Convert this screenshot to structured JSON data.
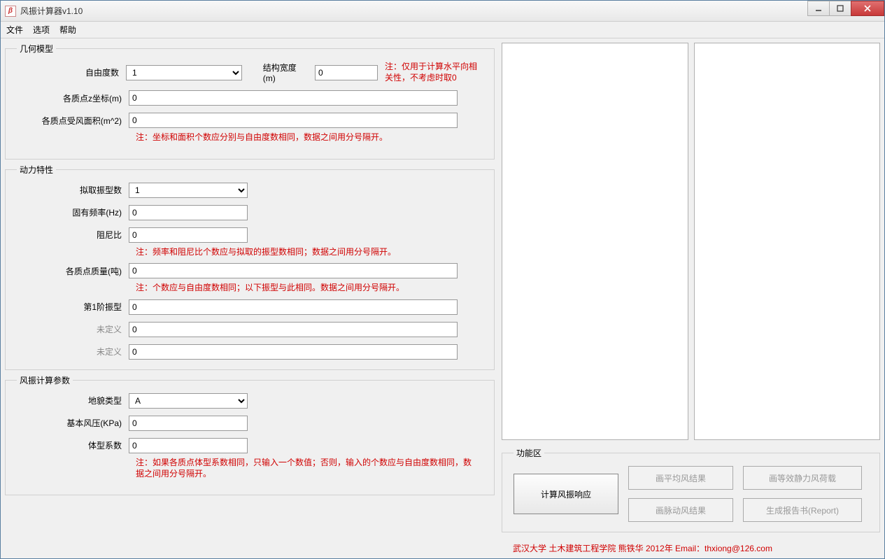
{
  "window": {
    "title": "风振计算器v1.10",
    "icon_label": "β"
  },
  "menu": {
    "file": "文件",
    "options": "选项",
    "help": "帮助"
  },
  "group_geometry": {
    "legend": "几何模型",
    "dof_label": "自由度数",
    "dof_value": "1",
    "width_label": "结构宽度(m)",
    "width_value": "0",
    "width_note": "注：仅用于计算水平向相关性，不考虑时取0",
    "z_label": "各质点z坐标(m)",
    "z_value": "0",
    "area_label": "各质点受风面积(m^2)",
    "area_value": "0",
    "note": "注：坐标和面积个数应分别与自由度数相同，数据之间用分号隔开。"
  },
  "group_dynamic": {
    "legend": "动力特性",
    "modes_label": "拟取振型数",
    "modes_value": "1",
    "freq_label": "固有频率(Hz)",
    "freq_value": "0",
    "damp_label": "阻尼比",
    "damp_value": "0",
    "note1": "注：频率和阻尼比个数应与拟取的振型数相同；数据之间用分号隔开。",
    "mass_label": "各质点质量(吨)",
    "mass_value": "0",
    "note2": "注：个数应与自由度数相同；以下振型与此相同。数据之间用分号隔开。",
    "mode1_label": "第1阶振型",
    "mode1_value": "0",
    "undef_label": "未定义",
    "undef1_value": "0",
    "undef2_value": "0"
  },
  "group_params": {
    "legend": "风振计算参数",
    "terrain_label": "地貌类型",
    "terrain_value": "A",
    "pressure_label": "基本风压(KPa)",
    "pressure_value": "0",
    "shape_label": "体型系数",
    "shape_value": "0",
    "note": "注：如果各质点体型系数相同，只输入一个数值；否则，输入的个数应与自由度数相同，数据之间用分号隔开。"
  },
  "group_func": {
    "legend": "功能区",
    "calc": "计算风振响应",
    "draw_mean": "画平均风结果",
    "draw_equiv": "画等效静力风荷载",
    "draw_fluc": "画脉动风结果",
    "report": "生成报告书(Report)"
  },
  "footer": "武汉大学  土木建筑工程学院  熊铁华  2012年    Email：thxiong@126.com"
}
